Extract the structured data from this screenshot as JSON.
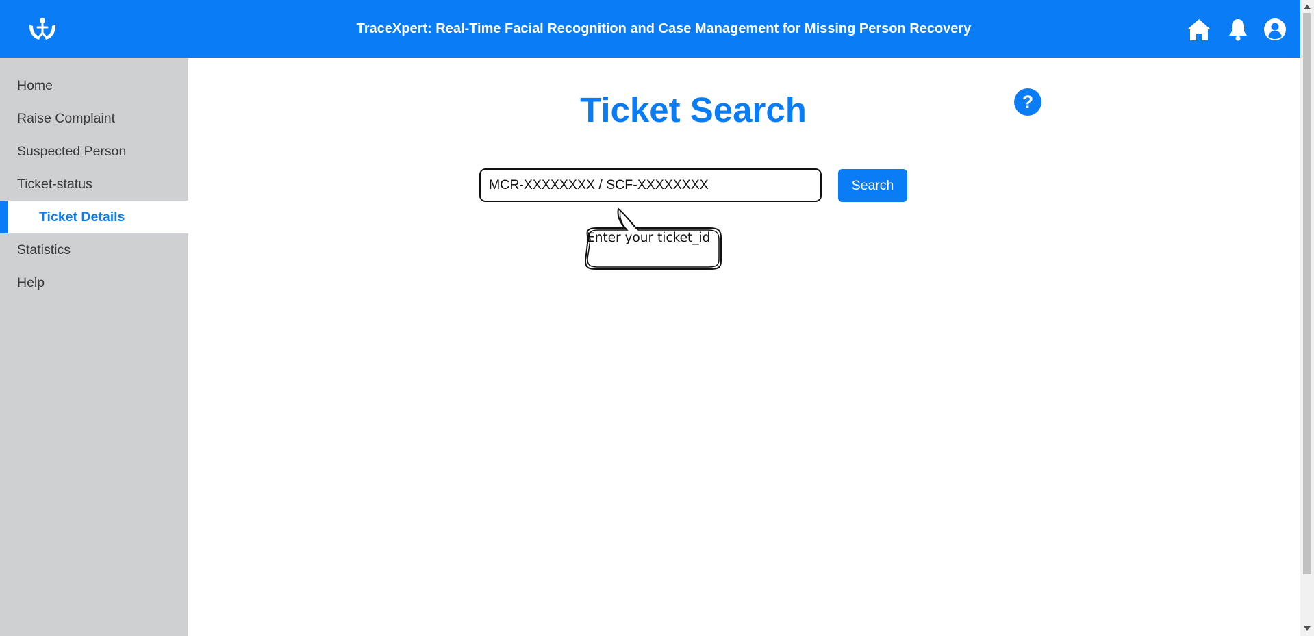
{
  "header": {
    "title": "TraceXpert: Real-Time Facial Recognition and Case Management for Missing Person Recovery",
    "logo_icon": "hands-person-logo-icon",
    "icons": [
      "home-icon",
      "bell-icon",
      "user-icon"
    ]
  },
  "sidebar": {
    "items": [
      {
        "label": "Home"
      },
      {
        "label": "Raise Complaint"
      },
      {
        "label": "Suspected Person"
      },
      {
        "label": "Ticket-status"
      },
      {
        "label": "Ticket Details",
        "active": true
      },
      {
        "label": "Statistics"
      },
      {
        "label": "Help"
      }
    ]
  },
  "main": {
    "title": "Ticket Search",
    "help_label": "?",
    "search": {
      "placeholder": "MCR-XXXXXXXX / SCF-XXXXXXXX",
      "button_label": "Search",
      "tooltip": "Enter your ticket_id"
    }
  },
  "colors": {
    "primary": "#0a7cf5",
    "sidebar_bg": "#cfd0d2"
  }
}
